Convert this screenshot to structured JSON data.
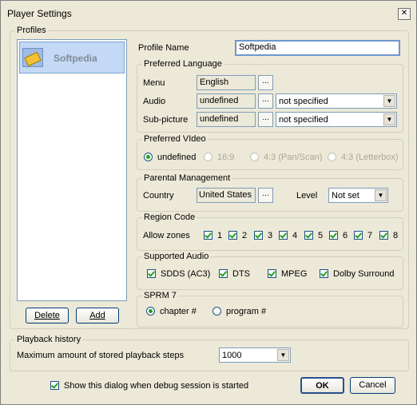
{
  "window": {
    "title": "Player Settings",
    "close_glyph": "✕"
  },
  "profiles": {
    "legend": "Profiles",
    "items": [
      {
        "name": "Softpedia"
      }
    ],
    "delete_label": "Delete",
    "add_label": "Add"
  },
  "profile_name": {
    "label": "Profile Name",
    "value": "Softpedia"
  },
  "language": {
    "legend": "Preferred Language",
    "menu_label": "Menu",
    "menu_value": "English",
    "audio_label": "Audio",
    "audio_value": "undefined",
    "audio_select": "not specified",
    "sub_label": "Sub-picture",
    "sub_value": "undefined",
    "sub_select": "not specified",
    "dots": "..."
  },
  "video": {
    "legend": "Preferred VIdeo",
    "options": [
      "undefined",
      "16:9",
      "4:3 (Pan/Scan)",
      "4:3 (Letterbox)"
    ],
    "selected": "undefined"
  },
  "parental": {
    "legend": "Parental Management",
    "country_label": "Country",
    "country_value": "United States",
    "level_label": "Level",
    "level_value": "Not set"
  },
  "region": {
    "legend": "Region Code",
    "allow_label": "Allow zones",
    "zones": [
      "1",
      "2",
      "3",
      "4",
      "5",
      "6",
      "7",
      "8"
    ]
  },
  "audio_support": {
    "legend": "Supported Audio",
    "options": [
      "SDDS (AC3)",
      "DTS",
      "MPEG",
      "Dolby Surround"
    ]
  },
  "sprm": {
    "legend": "SPRM 7",
    "options": [
      "chapter #",
      "program #"
    ],
    "selected": "chapter #"
  },
  "history": {
    "legend": "Playback history",
    "label": "Maximum amount of stored playback steps",
    "value": "1000"
  },
  "footer": {
    "debug_label": "Show this dialog when debug session is started",
    "ok_label": "OK",
    "cancel_label": "Cancel"
  },
  "colors": {
    "check_green": "#21a121",
    "field_border": "#7f9db9",
    "selection": "#c3d9f5"
  },
  "icons": {
    "close": "close-icon",
    "dropdown": "chevron-down-icon",
    "profile": "profile-icon"
  }
}
